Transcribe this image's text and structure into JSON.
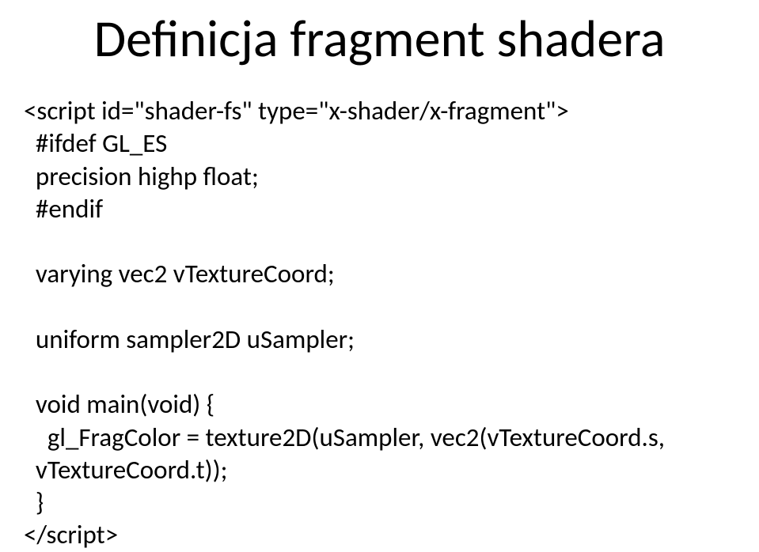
{
  "title": "Definicja fragment shadera",
  "code": {
    "l1": "<script id=\"shader-fs\" type=\"x-shader/x-fragment\">",
    "l2": "  #ifdef GL_ES",
    "l3": "  precision highp float;",
    "l4": "  #endif",
    "blank1": "",
    "l5": "  varying vec2 vTextureCoord;",
    "blank2": "",
    "l6": "  uniform sampler2D uSampler;",
    "blank3": "",
    "l7": "  void main(void) {",
    "l8": "    gl_FragColor = texture2D(uSampler, vec2(vTextureCoord.s,",
    "l8b": "  vTextureCoord.t));",
    "l9": "  }",
    "l10": "</script>"
  }
}
